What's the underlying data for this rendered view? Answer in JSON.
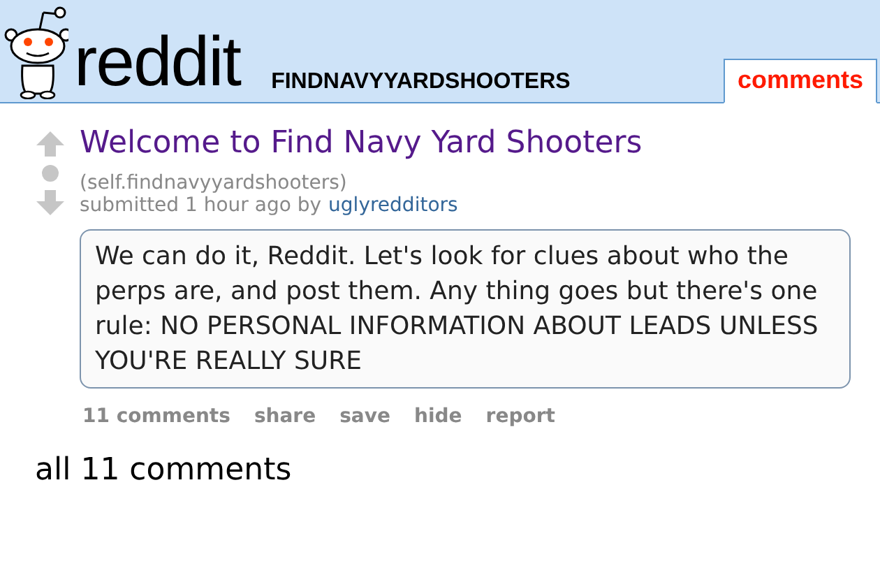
{
  "header": {
    "logo_text": "reddit",
    "subreddit": "FINDNAVYYARDSHOOTERS",
    "tabs": [
      {
        "label": "comments",
        "selected": true
      }
    ]
  },
  "post": {
    "title": "Welcome to Find Navy Yard Shooters",
    "domain": "(self.findnavyyardshooters)",
    "submitted": "submitted 1 hour ago by",
    "author": "uglyredditors",
    "body": "We can do it, Reddit. Let's look for clues about who the perps are, and post them. Any thing goes but there's one rule: NO PERSONAL INFORMATION ABOUT LEADS UNLESS YOU'RE REALLY SURE",
    "links": [
      "11 comments",
      "share",
      "save",
      "hide",
      "report"
    ]
  },
  "comments_heading": "all 11 comments"
}
